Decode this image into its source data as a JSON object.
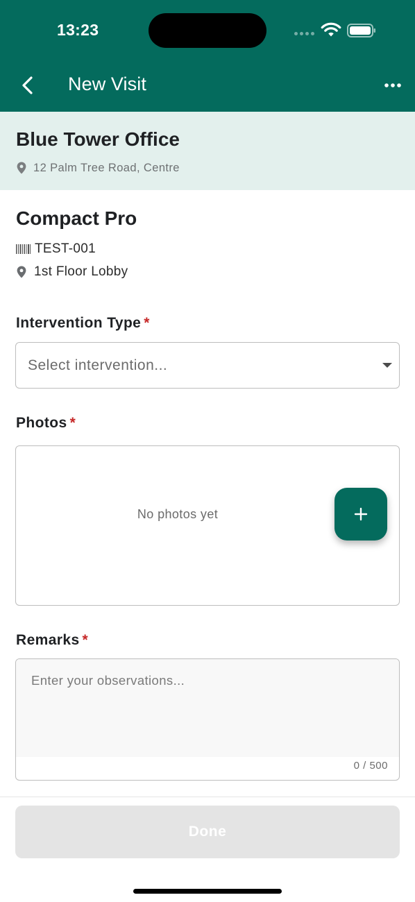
{
  "status_bar": {
    "time": "13:23"
  },
  "header": {
    "title": "New Visit",
    "back_icon": "chevron-left-icon",
    "more_icon": "more-horizontal-icon",
    "color": "#046b5d"
  },
  "site": {
    "name": "Blue Tower Office",
    "address": "12 Palm Tree Road, Centre",
    "banner_color": "#e3f0ed"
  },
  "device": {
    "name": "Compact Pro",
    "serial": "TEST-001",
    "location": "1st Floor Lobby"
  },
  "form": {
    "required_marker": "*",
    "required_color": "#c62828",
    "intervention": {
      "label": "Intervention Type",
      "placeholder": "Select intervention..."
    },
    "photos": {
      "label": "Photos",
      "empty_text": "No photos yet",
      "add_icon": "plus-icon"
    },
    "remarks": {
      "label": "Remarks",
      "placeholder": "Enter your observations...",
      "counter": "0 / 500"
    }
  },
  "footer": {
    "done_label": "Done"
  }
}
